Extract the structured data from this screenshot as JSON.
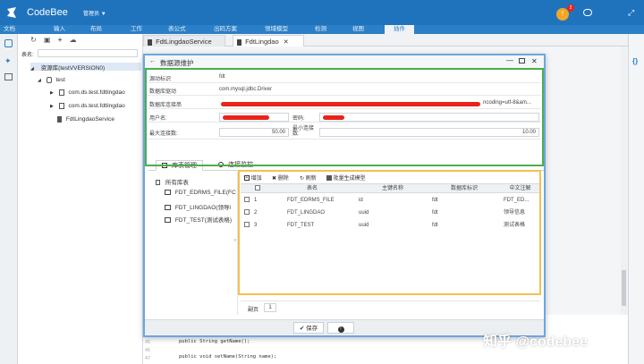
{
  "app": {
    "title": "CodeBee",
    "user": "管理员",
    "notifications": "2"
  },
  "menu": {
    "items": [
      "文档",
      "输入",
      "布局",
      "工作",
      "表公式",
      "出码方案",
      "领域模型",
      "检测",
      "视图",
      "插件"
    ],
    "active_index": 9
  },
  "sidebar": {
    "search_label": "表名:",
    "tree": [
      "资源库(testVVERSION0)",
      "test",
      "com.ds.test.fdtlingdao",
      "com.ds.test.fdtlingdao",
      "FdtLingdaoService"
    ]
  },
  "editor": {
    "tabs": [
      {
        "label": "FdtLingdaoService"
      },
      {
        "label": "FdtLingdao"
      }
    ],
    "active_tab": 1,
    "code": {
      "line_numbers": [
        "45",
        "46",
        "47"
      ],
      "lines": [
        "public String getName();",
        "public void setName(String  name);"
      ]
    }
  },
  "dialog": {
    "title": "数据源维护",
    "fields": {
      "source_id": {
        "label": "源动标识",
        "value": "fdt"
      },
      "driver": {
        "label": "数据库驱动",
        "value": "com.mysql.jdbc.Driver"
      },
      "url": {
        "label": "数据库连接串",
        "value": "ncoding=utf-8&am..."
      },
      "username": {
        "label": "用户名:"
      },
      "password": {
        "label": "密码:"
      },
      "max_conn": {
        "label": "最大连接数:",
        "value": "50.00"
      },
      "min_conn": {
        "label": "最小连接数:",
        "value": "10.00"
      }
    },
    "subtabs": [
      {
        "label": "库表管理"
      },
      {
        "label": "连接监控"
      }
    ],
    "active_subtab": 0,
    "library": {
      "root": "所有库表",
      "tables": [
        "FDT_EDRMS_FILE(FC",
        "FDT_LINGDAO(领导l",
        "FDT_TEST(测试表格)"
      ]
    },
    "toolbar": {
      "add": "增加",
      "delete": "删除",
      "refresh": "刷新",
      "batch": "批量生成模型"
    },
    "grid": {
      "columns": [
        "表名",
        "主键名称",
        "数据库标识",
        "中文注解"
      ],
      "rows": [
        {
          "n": "1",
          "table": "FDT_EDRMS_FILE",
          "pk": "id",
          "db": "fdt",
          "cn": "FDT_ED..."
        },
        {
          "n": "2",
          "table": "FDT_LINGDAO",
          "pk": "uuid",
          "db": "fdt",
          "cn": "领导信息"
        },
        {
          "n": "3",
          "table": "FDT_TEST",
          "pk": "uuid",
          "db": "fdt",
          "cn": "测试表格"
        }
      ]
    },
    "pager": {
      "label": "副页",
      "page": "1"
    },
    "footer": {
      "save": "保存"
    }
  },
  "watermark": "知乎 @codebee",
  "colors": {
    "primary": "#1f73bd",
    "green_highlight": "#4cae4c",
    "yellow_highlight": "#f2c14e",
    "dialog_border": "#6aa7e0",
    "redaction": "#e8231a"
  }
}
